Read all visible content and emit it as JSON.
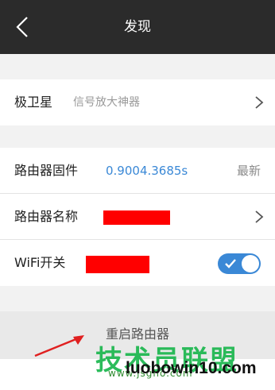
{
  "header": {
    "title": "发现"
  },
  "section1": {
    "row": {
      "label": "极卫星",
      "sub": "信号放大神器"
    }
  },
  "section2": {
    "firmware": {
      "label": "路由器固件",
      "version": "0.9004.3685s",
      "status": "最新"
    },
    "name": {
      "label": "路由器名称"
    },
    "wifi": {
      "label": "WiFi开关",
      "enabled": true
    }
  },
  "actions": {
    "reboot_label": "重启路由器"
  },
  "watermark": {
    "cn": "技术员联盟",
    "url": "www.jsgho.com",
    "site": "luobowin10.com"
  },
  "colors": {
    "header_bg": "#2b2b2b",
    "accent": "#3a88d6",
    "redaction": "#ff0000"
  }
}
